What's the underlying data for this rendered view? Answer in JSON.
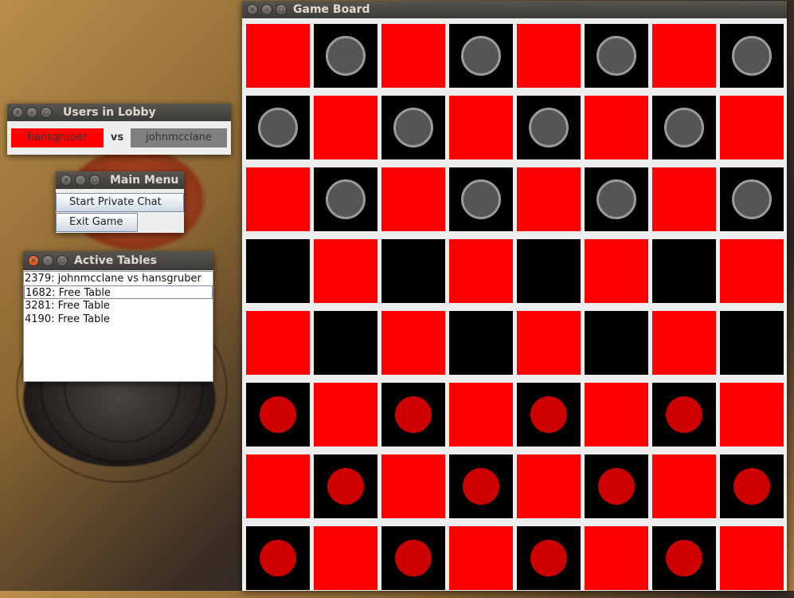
{
  "game_board": {
    "title": "Game Board",
    "rows": [
      [
        "R",
        "B",
        "R",
        "B",
        "R",
        "B",
        "R",
        "B"
      ],
      [
        "B",
        "R",
        "B",
        "R",
        "B",
        "R",
        "B",
        "R"
      ],
      [
        "R",
        "B",
        "R",
        "B",
        "R",
        "B",
        "R",
        "B"
      ],
      [
        "E",
        "R",
        "E",
        "R",
        "E",
        "R",
        "E",
        "R"
      ],
      [
        "R",
        "E",
        "R",
        "E",
        "R",
        "E",
        "R",
        "E"
      ],
      [
        "P",
        "R",
        "P",
        "R",
        "P",
        "R",
        "P",
        "R"
      ],
      [
        "R",
        "P",
        "R",
        "P",
        "R",
        "P",
        "R",
        "P"
      ],
      [
        "P",
        "R",
        "P",
        "R",
        "P",
        "R",
        "P",
        "R"
      ]
    ],
    "legend": {
      "R": "red square",
      "E": "empty black square",
      "B": "black square with gray piece",
      "P": "black square with red piece"
    },
    "colors": {
      "red_square": "#ff0000",
      "dark_square": "#000000",
      "gray_piece": "#555555",
      "red_piece": "#cc0000"
    }
  },
  "lobby": {
    "title": "Users in Lobby",
    "player1": "hansgruber",
    "vs": "vs",
    "player2": "johnmcclane"
  },
  "main_menu": {
    "title": "Main Menu",
    "start_chat": "Start Private Chat",
    "exit_game": "Exit Game"
  },
  "active_tables": {
    "title": "Active Tables",
    "items": [
      "2379: johnmcclane vs hansgruber",
      "1682: Free Table",
      "3281: Free Table",
      "4190: Free Table"
    ],
    "selected_index": 1
  }
}
